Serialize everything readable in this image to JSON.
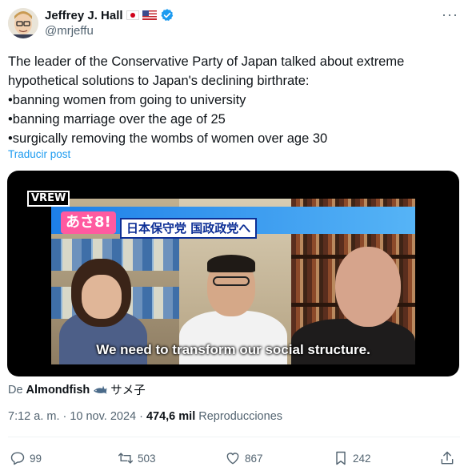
{
  "author": {
    "display_name": "Jeffrey J. Hall",
    "handle": "@mrjeffu"
  },
  "tweet": {
    "lines": [
      "The leader of the Conservative Party of Japan talked about extreme",
      "hypothetical solutions to Japan's declining birthrate:",
      "•banning women from going to university",
      "•banning marriage over the age of 25",
      "•surgically removing the wombs of women over age 30"
    ],
    "translate_label": "Traducir post"
  },
  "media": {
    "watermark": "VREW",
    "banner_logo": "あさ8!",
    "banner_text": "日本保守党 国政政党へ",
    "subtitle": "We need to transform our social structure."
  },
  "attribution": {
    "prefix": "De",
    "source_name": "Almondfish",
    "source_suffix": "サメ子"
  },
  "meta": {
    "time": "7:12 a. m.",
    "separator": "·",
    "date": "10 nov. 2024",
    "views_count": "474,6 mil",
    "views_label": "Reproducciones"
  },
  "actions": {
    "replies": "99",
    "reposts": "503",
    "likes": "867",
    "bookmarks": "242"
  },
  "colors": {
    "accent": "#1d9bf0",
    "secondary_text": "#536471"
  }
}
